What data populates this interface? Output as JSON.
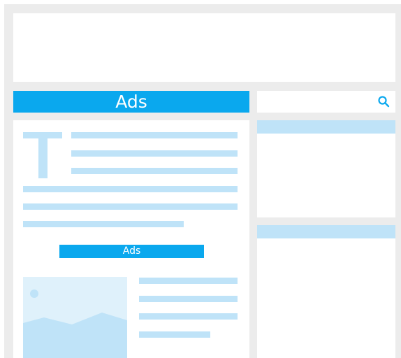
{
  "ads": {
    "banner_label": "Ads",
    "inline_label": "Ads"
  },
  "icons": {
    "search": "search-icon",
    "text": "text-icon",
    "image": "image-placeholder-icon"
  },
  "colors": {
    "accent": "#0aa8ee",
    "placeholder": "#bfe3f8",
    "frame": "#ececec"
  }
}
